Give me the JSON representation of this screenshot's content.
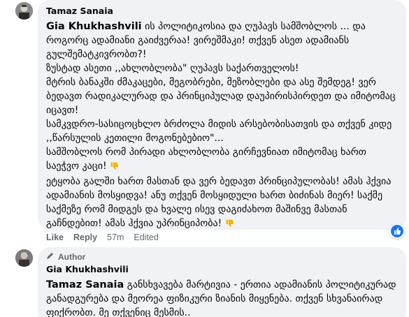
{
  "comments": [
    {
      "author": "Tamaz Sanaia",
      "reply_to": "Gia Khukhashvili",
      "p1_rest": " ის პოლიტიკოსია და ღუპავს სამშობლოს ... და როგორც ადამიანი გაიძვერაა! ვირეშმაკი! თქვენ ასეთ ადამიანს გულშემატკივრობთ?!",
      "p2": "ზუსტად ასეთი ,,ახლობლობა\" ღუპავს საქართველოს!",
      "p3": "მტრის ბანაკში ძმაკაცები, მეგობრები, მეზობლები და ასე შემდეგ! ვერ ბედავთ რადიკალურად და პრინციპულად დაუპირისპირდეთ და იმიტომაც იცავთ!",
      "p4": "სამკვდრო-სასიცოცხლო ბრძოლა მიდის არსებობისათვის და თქვენ კიდე ,,წარსულის კეთილი მოგონებებიო\"...",
      "p5": "სამშობლოს რომ პირადი ახლობლობა გირჩევნიათ იმიტომაც ხართ საეჭვო კაცი!",
      "p6": "ეტყობა გალში ხართ მასთან და ვერ ბედავთ პრინციპულობას! ამას ჰქვია ადამიანის მოსყიდვა! ანუ თქვენ მოსყიდული ხართ ბიძინას მიერ! საქმე საქმეზე რომ მიდგეს და ხვალე ისევ დაგიძახოთ მაშინვე მასთან გაჩნდებით! ამას ჰქვია უპრინციპობა!",
      "actions": {
        "like": "Like",
        "reply": "Reply",
        "time": "57m",
        "edited": "Edited"
      },
      "reaction": "like-icon"
    },
    {
      "badge": "Author",
      "author": "Gia Khukhashvili",
      "reply_to": "Tamaz Sanaia",
      "body_rest": " განსხვავება მარტივია - ერთია ადამიანის პოლიტიკურად განადგურება და მეორეა ფიზიკური ზიანის მიყენება. თქვენ სხვანაირად ფიქრობთ. მე თქვენიც მესმის.."
    }
  ],
  "colors": {
    "bubble": "#f0f2f5",
    "meta": "#65676b",
    "like_blue": "#1877f2"
  }
}
